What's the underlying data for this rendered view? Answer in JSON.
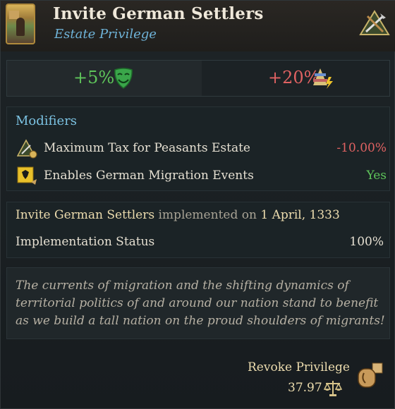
{
  "header": {
    "title": "Invite German Settlers",
    "subtitle": "Estate Privilege"
  },
  "stats": {
    "left": {
      "value": "+5%",
      "icon": "happy-mask-icon",
      "color": "#5ec45a"
    },
    "right": {
      "value": "+20%",
      "icon": "estate-power-pyramid-icon",
      "color": "#e06262"
    }
  },
  "modifiers": {
    "heading": "Modifiers",
    "items": [
      {
        "icon": "peasant-estate-tax-icon",
        "label": "Maximum Tax for Peasants Estate",
        "value": "-10.00%",
        "value_color": "#e06262"
      },
      {
        "icon": "german-flag-migration-icon",
        "label": "Enables German Migration Events",
        "value": "Yes",
        "value_color": "#5ec45a"
      }
    ]
  },
  "implementation": {
    "name": "Invite German Settlers",
    "connector": "implemented on",
    "date": "1 April, 1333",
    "status_label": "Implementation Status",
    "status_value": "100%"
  },
  "description": "The currents of migration and the shifting dynamics of territorial politics of and around our nation stand to benefit as we build a tall nation on the proud shoulders of migrants!",
  "revoke": {
    "label": "Revoke Privilege",
    "cost": "37.97",
    "cost_icon": "scales-icon",
    "button_icon": "revoke-hand-icon"
  },
  "colors": {
    "accent_blue": "#7cc3e3",
    "gold_text": "#ecdcae",
    "positive": "#5ec45a",
    "negative": "#e06262"
  }
}
